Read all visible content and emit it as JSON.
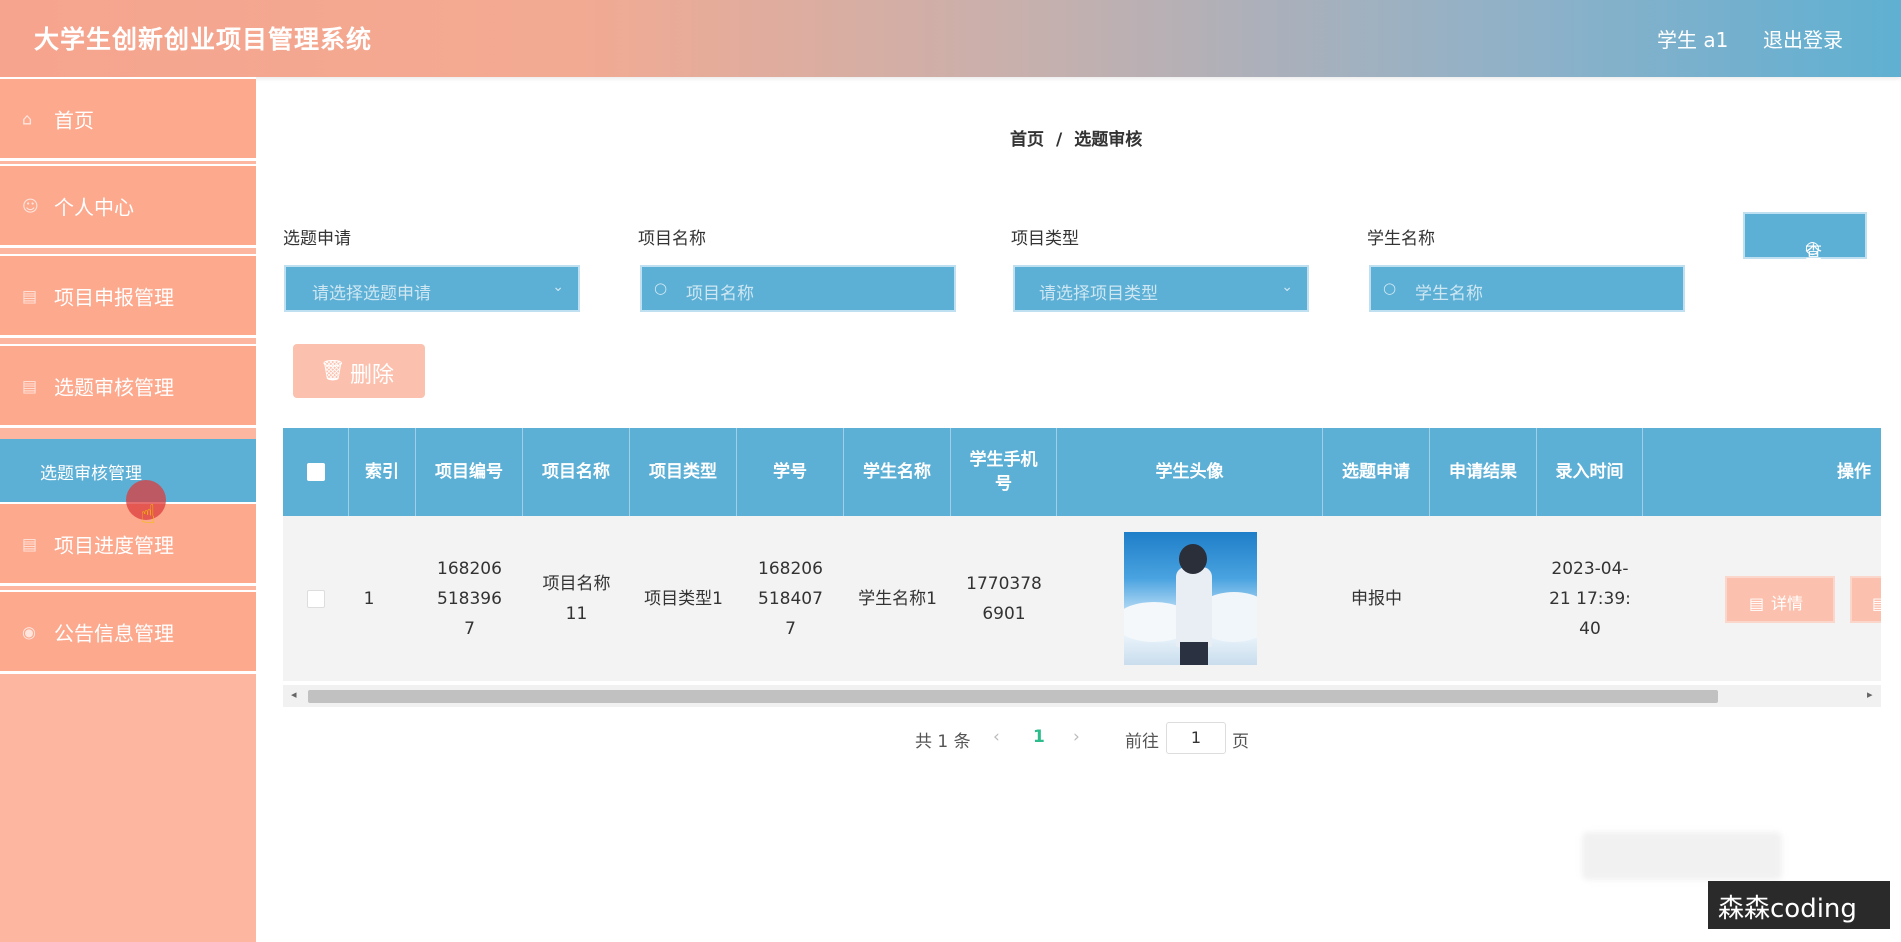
{
  "header": {
    "title": "大学生创新创业项目管理系统",
    "user": "学生 a1",
    "logout": "退出登录"
  },
  "sidebar": {
    "items": [
      {
        "label": "首页",
        "icon": "home-icon"
      },
      {
        "label": "个人中心",
        "icon": "user-icon"
      },
      {
        "label": "项目申报管理",
        "icon": "folder-icon"
      },
      {
        "label": "选题审核管理",
        "icon": "folder-icon"
      },
      {
        "label": "项目进度管理",
        "icon": "folder-icon"
      },
      {
        "label": "公告信息管理",
        "icon": "bell-icon"
      }
    ],
    "active_sub": "选题审核管理"
  },
  "breadcrumb": {
    "home": "首页",
    "sep": "/",
    "current": "选题审核"
  },
  "filters": {
    "apply": {
      "label": "选题申请",
      "placeholder": "请选择选题申请"
    },
    "project_name": {
      "label": "项目名称",
      "placeholder": "项目名称"
    },
    "project_type": {
      "label": "项目类型",
      "placeholder": "请选择项目类型"
    },
    "student_name": {
      "label": "学生名称",
      "placeholder": "学生名称"
    },
    "query": "查询"
  },
  "actions": {
    "delete": "删除"
  },
  "table": {
    "headers": {
      "index": "索引",
      "project_no": "项目编号",
      "project_name": "项目名称",
      "project_type": "项目类型",
      "student_no": "学号",
      "student_name": "学生名称",
      "phone": "学生手机号",
      "avatar": "学生头像",
      "apply": "选题申请",
      "result": "申请结果",
      "time": "录入时间",
      "ops": "操作"
    },
    "rows": [
      {
        "index": "1",
        "project_no": "1682065183967",
        "project_name": "项目名称11",
        "project_type": "项目类型1",
        "student_no": "1682065184077",
        "student_name": "学生名称1",
        "phone": "17703786901",
        "apply": "申报中",
        "result": "",
        "time": "2023-04-21 17:39:40",
        "detail": "详情"
      }
    ]
  },
  "pagination": {
    "total": "共 1 条",
    "current": "1",
    "goto": "前往",
    "page_input": "1",
    "unit": "页"
  },
  "watermark": "森森coding",
  "colors": {
    "accent_blue": "#5cafd5",
    "sidebar_salmon": "#fda98e",
    "button_peach": "#fcc1ae"
  }
}
